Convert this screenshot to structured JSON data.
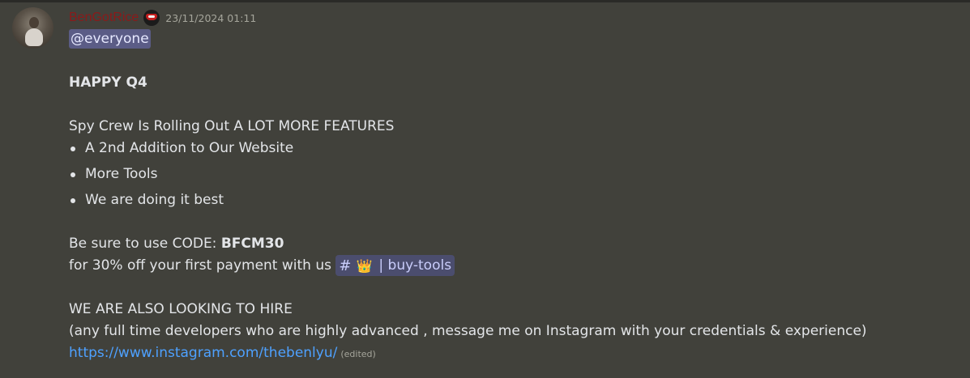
{
  "message": {
    "author": {
      "username": "BenGotRice",
      "name_color": "#8b1a1a",
      "role_icon": "ninja-badge-icon"
    },
    "timestamp": "23/11/2024 01:11",
    "mention": "@everyone",
    "heading": "HAPPY Q4",
    "intro": "Spy Crew Is Rolling Out A LOT MORE FEATURES",
    "features": [
      "A 2nd Addition to Our Website",
      "More Tools",
      "We are doing it best"
    ],
    "code_prefix": "Be sure to use CODE: ",
    "code": "BFCM30",
    "offer_text": "for 30% off your first payment with us",
    "channel": {
      "hash": "#",
      "emoji": "👑",
      "name": "| buy-tools"
    },
    "hire_heading": "WE ARE ALSO LOOKING TO HIRE",
    "hire_details": "(any full time developers who are highly advanced , message me on Instagram with your credentials & experience)",
    "link": "https://www.instagram.com/thebenlyu/",
    "edited_label": "(edited)"
  }
}
